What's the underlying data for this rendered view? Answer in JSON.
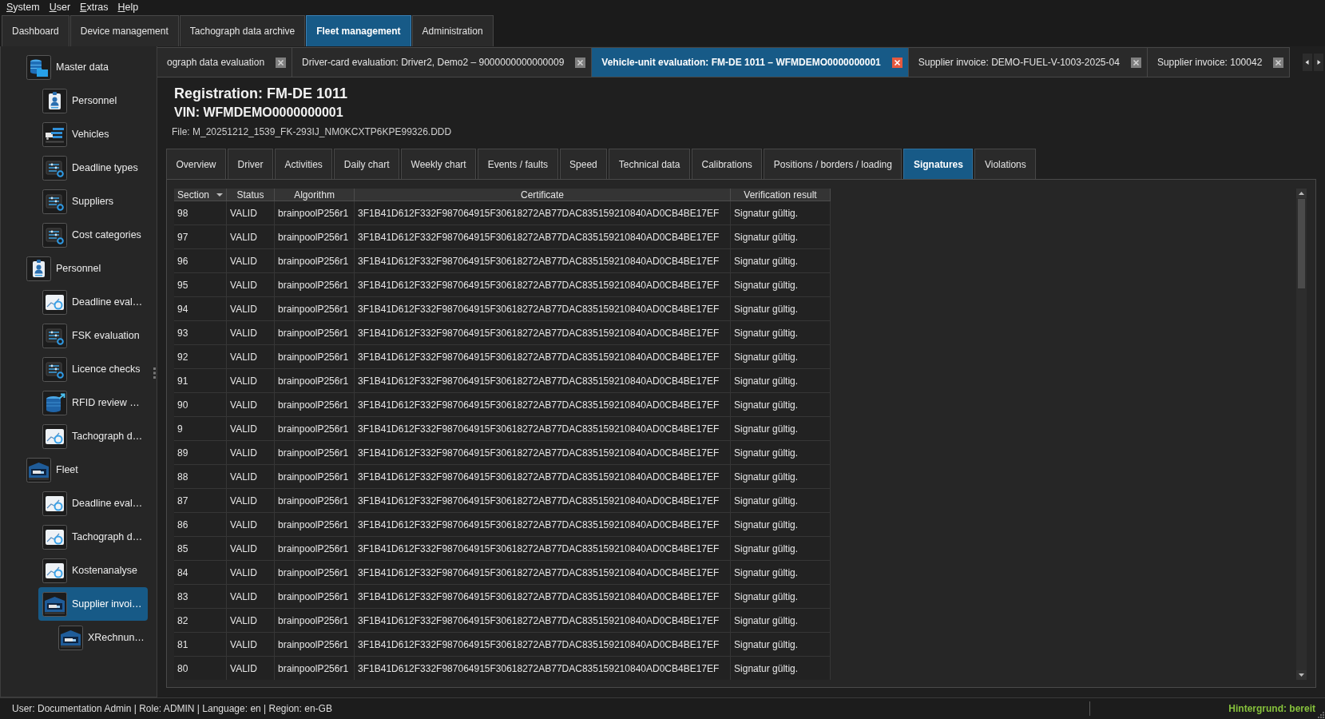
{
  "menu": [
    "System",
    "User",
    "Extras",
    "Help"
  ],
  "main_tabs": [
    {
      "label": "Dashboard",
      "selected": false
    },
    {
      "label": "Device management",
      "selected": false
    },
    {
      "label": "Tachograph data archive",
      "selected": false
    },
    {
      "label": "Fleet management",
      "selected": true
    },
    {
      "label": "Administration",
      "selected": false
    }
  ],
  "sidebar": {
    "items": [
      {
        "label": "Master data",
        "kind": "database",
        "selected": false,
        "children": [
          {
            "label": "Personnel",
            "kind": "badge",
            "selected": false
          },
          {
            "label": "Vehicles",
            "kind": "vehicles",
            "selected": false
          },
          {
            "label": "Deadline types",
            "kind": "list",
            "selected": false
          },
          {
            "label": "Suppliers",
            "kind": "list",
            "selected": false
          },
          {
            "label": "Cost categories",
            "kind": "list",
            "selected": false
          }
        ]
      },
      {
        "label": "Personnel",
        "kind": "badge",
        "selected": false,
        "children": [
          {
            "label": "Deadline eval…",
            "kind": "chart",
            "selected": false
          },
          {
            "label": "FSK evaluation",
            "kind": "list",
            "selected": false
          },
          {
            "label": "Licence checks",
            "kind": "list",
            "selected": false
          },
          {
            "label": "RFID review …",
            "kind": "export",
            "selected": false
          },
          {
            "label": "Tachograph d…",
            "kind": "chart",
            "selected": false
          }
        ]
      },
      {
        "label": "Fleet",
        "kind": "fleet",
        "selected": false,
        "children": [
          {
            "label": "Deadline eval…",
            "kind": "chart",
            "selected": false
          },
          {
            "label": "Tachograph d…",
            "kind": "chart",
            "selected": false
          },
          {
            "label": "Kostenanalyse",
            "kind": "chart",
            "selected": false
          },
          {
            "label": "Supplier invoi…",
            "kind": "fleet",
            "selected": true,
            "children": [
              {
                "label": "XRechnun…",
                "kind": "fleet",
                "selected": false
              }
            ]
          }
        ]
      }
    ]
  },
  "document_tabs": [
    {
      "label": "ograph data evaluation",
      "selected": false
    },
    {
      "label": "Driver-card evaluation: Driver2, Demo2 – 9000000000000009",
      "selected": false
    },
    {
      "label": "Vehicle-unit evaluation: FM-DE 1011 – WFMDEMO0000000001",
      "selected": true
    },
    {
      "label": "Supplier invoice: DEMO-FUEL-V-1003-2025-04",
      "selected": false
    },
    {
      "label": "Supplier invoice: 100042",
      "selected": false
    }
  ],
  "header": {
    "registration": "Registration: FM-DE 1011",
    "vin": "VIN: WFMDEMO0000000001",
    "file": "File: M_20251212_1539_FK-293IJ_NM0KCXTP6KPE99326.DDD"
  },
  "detail_tabs": [
    {
      "label": "Overview",
      "selected": false
    },
    {
      "label": "Driver",
      "selected": false
    },
    {
      "label": "Activities",
      "selected": false
    },
    {
      "label": "Daily chart",
      "selected": false
    },
    {
      "label": "Weekly chart",
      "selected": false
    },
    {
      "label": "Events / faults",
      "selected": false
    },
    {
      "label": "Speed",
      "selected": false
    },
    {
      "label": "Technical data",
      "selected": false
    },
    {
      "label": "Calibrations",
      "selected": false
    },
    {
      "label": "Positions / borders / loading",
      "selected": false
    },
    {
      "label": "Signatures",
      "selected": true
    },
    {
      "label": "Violations",
      "selected": false
    }
  ],
  "table": {
    "columns": [
      {
        "label": "Section",
        "sorted": true
      },
      {
        "label": "Status",
        "sorted": false
      },
      {
        "label": "Algorithm",
        "sorted": false
      },
      {
        "label": "Certificate",
        "sorted": false
      },
      {
        "label": "Verification result",
        "sorted": false
      }
    ],
    "rows": [
      [
        "98",
        "VALID",
        "brainpoolP256r1",
        "3F1B41D612F332F987064915F30618272AB77DAC835159210840AD0CB4BE17EF",
        "Signatur gültig."
      ],
      [
        "97",
        "VALID",
        "brainpoolP256r1",
        "3F1B41D612F332F987064915F30618272AB77DAC835159210840AD0CB4BE17EF",
        "Signatur gültig."
      ],
      [
        "96",
        "VALID",
        "brainpoolP256r1",
        "3F1B41D612F332F987064915F30618272AB77DAC835159210840AD0CB4BE17EF",
        "Signatur gültig."
      ],
      [
        "95",
        "VALID",
        "brainpoolP256r1",
        "3F1B41D612F332F987064915F30618272AB77DAC835159210840AD0CB4BE17EF",
        "Signatur gültig."
      ],
      [
        "94",
        "VALID",
        "brainpoolP256r1",
        "3F1B41D612F332F987064915F30618272AB77DAC835159210840AD0CB4BE17EF",
        "Signatur gültig."
      ],
      [
        "93",
        "VALID",
        "brainpoolP256r1",
        "3F1B41D612F332F987064915F30618272AB77DAC835159210840AD0CB4BE17EF",
        "Signatur gültig."
      ],
      [
        "92",
        "VALID",
        "brainpoolP256r1",
        "3F1B41D612F332F987064915F30618272AB77DAC835159210840AD0CB4BE17EF",
        "Signatur gültig."
      ],
      [
        "91",
        "VALID",
        "brainpoolP256r1",
        "3F1B41D612F332F987064915F30618272AB77DAC835159210840AD0CB4BE17EF",
        "Signatur gültig."
      ],
      [
        "90",
        "VALID",
        "brainpoolP256r1",
        "3F1B41D612F332F987064915F30618272AB77DAC835159210840AD0CB4BE17EF",
        "Signatur gültig."
      ],
      [
        "9",
        "VALID",
        "brainpoolP256r1",
        "3F1B41D612F332F987064915F30618272AB77DAC835159210840AD0CB4BE17EF",
        "Signatur gültig."
      ],
      [
        "89",
        "VALID",
        "brainpoolP256r1",
        "3F1B41D612F332F987064915F30618272AB77DAC835159210840AD0CB4BE17EF",
        "Signatur gültig."
      ],
      [
        "88",
        "VALID",
        "brainpoolP256r1",
        "3F1B41D612F332F987064915F30618272AB77DAC835159210840AD0CB4BE17EF",
        "Signatur gültig."
      ],
      [
        "87",
        "VALID",
        "brainpoolP256r1",
        "3F1B41D612F332F987064915F30618272AB77DAC835159210840AD0CB4BE17EF",
        "Signatur gültig."
      ],
      [
        "86",
        "VALID",
        "brainpoolP256r1",
        "3F1B41D612F332F987064915F30618272AB77DAC835159210840AD0CB4BE17EF",
        "Signatur gültig."
      ],
      [
        "85",
        "VALID",
        "brainpoolP256r1",
        "3F1B41D612F332F987064915F30618272AB77DAC835159210840AD0CB4BE17EF",
        "Signatur gültig."
      ],
      [
        "84",
        "VALID",
        "brainpoolP256r1",
        "3F1B41D612F332F987064915F30618272AB77DAC835159210840AD0CB4BE17EF",
        "Signatur gültig."
      ],
      [
        "83",
        "VALID",
        "brainpoolP256r1",
        "3F1B41D612F332F987064915F30618272AB77DAC835159210840AD0CB4BE17EF",
        "Signatur gültig."
      ],
      [
        "82",
        "VALID",
        "brainpoolP256r1",
        "3F1B41D612F332F987064915F30618272AB77DAC835159210840AD0CB4BE17EF",
        "Signatur gültig."
      ],
      [
        "81",
        "VALID",
        "brainpoolP256r1",
        "3F1B41D612F332F987064915F30618272AB77DAC835159210840AD0CB4BE17EF",
        "Signatur gültig."
      ],
      [
        "80",
        "VALID",
        "brainpoolP256r1",
        "3F1B41D612F332F987064915F30618272AB77DAC835159210840AD0CB4BE17EF",
        "Signatur gültig."
      ]
    ]
  },
  "status_bar": {
    "info": "User: Documentation Admin | Role: ADMIN | Language: en | Region: en-GB",
    "background_status": "Hintergrund: bereit"
  }
}
